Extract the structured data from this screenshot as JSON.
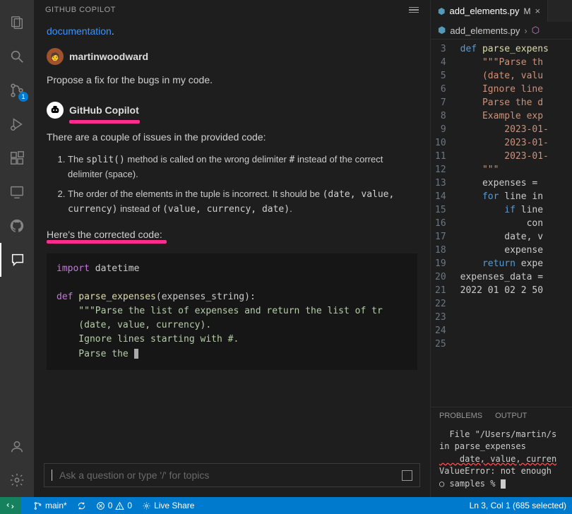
{
  "activity": {
    "scm_badge": "1"
  },
  "copilot": {
    "header": "GITHUB COPILOT",
    "doc_link": "documentation",
    "user_msg": {
      "name": "martinwoodward",
      "text": "Propose a fix for the bugs in my code."
    },
    "bot_msg": {
      "name": "GitHub Copilot",
      "intro": "There are a couple of issues in the provided code:",
      "issues": [
        {
          "pre": "The ",
          "code": "split()",
          "mid": " method is called on the wrong delimiter ",
          "code2": "#",
          "post": " instead of the correct delimiter (space)."
        },
        {
          "pre": "The order of the elements in the tuple is incorrect. It should be ",
          "code": "(date, value, currency)",
          "mid": " instead of ",
          "code2": "(value, currency, date)",
          "post": "."
        }
      ],
      "outro": "Here's the corrected code:",
      "code": {
        "l1_kw": "import",
        "l1_rest": " datetime",
        "l3_kw": "def",
        "l3_fn": " parse_expenses",
        "l3_rest": "(expenses_string):",
        "l4": "    \"\"\"Parse the list of expenses and return the list of tr",
        "l5": "    (date, value, currency).",
        "l6": "    Ignore lines starting with #.",
        "l7": "    Parse the "
      }
    },
    "input_placeholder": "Ask a question or type '/' for topics"
  },
  "editor": {
    "tab_icon": "⬢",
    "tab_name": "add_elements.py",
    "tab_mod": "M",
    "crumb": "add_elements.py",
    "gutter": [
      "3",
      "4",
      "5",
      "6",
      "7",
      "8",
      "9",
      "10",
      "11",
      "12",
      "13",
      "14",
      "15",
      "16",
      "17",
      "18",
      "19",
      "20",
      "21",
      "22",
      "23",
      "24",
      "25"
    ],
    "lines": {
      "l3": {
        "kw": "def",
        "fn": " parse_expens"
      },
      "l4": "    \"\"\"Parse th",
      "l5": "    (date, valu",
      "l6": "    Ignore line",
      "l7": "    Parse the d",
      "l8": "    Example exp",
      "l9": "        2023-01-",
      "l10": "        2023-01-",
      "l11": "        2023-01-",
      "l12": "    \"\"\"",
      "l13": "    expenses = ",
      "l13_kw": "",
      "l14_pre": "    ",
      "l14_kw": "for",
      "l14_rest": " line in",
      "l15_pre": "        ",
      "l15_kw": "if",
      "l15_rest": " line",
      "l16": "            con",
      "l17": "        date, v",
      "l18": "        expense",
      "l19": "",
      "l20": "",
      "l21_pre": "    ",
      "l21_kw": "return",
      "l21_rest": " expe",
      "l22": "",
      "l23": "expenses_data =",
      "l24": "2022 01 02 2 50"
    },
    "terminal_tabs": {
      "problems": "PROBLEMS",
      "output": "OUTPUT"
    },
    "terminal": {
      "l1": "  File \"/Users/martin/s",
      "l2": "in parse_expenses",
      "l3": "    date, value, curren",
      "l4": "ValueError: not enough ",
      "l5": "○ samples % "
    }
  },
  "status": {
    "branch": "main*",
    "errors": "0",
    "warnings": "0",
    "live": "Live Share",
    "selection": "Ln 3, Col 1 (685 selected)"
  }
}
